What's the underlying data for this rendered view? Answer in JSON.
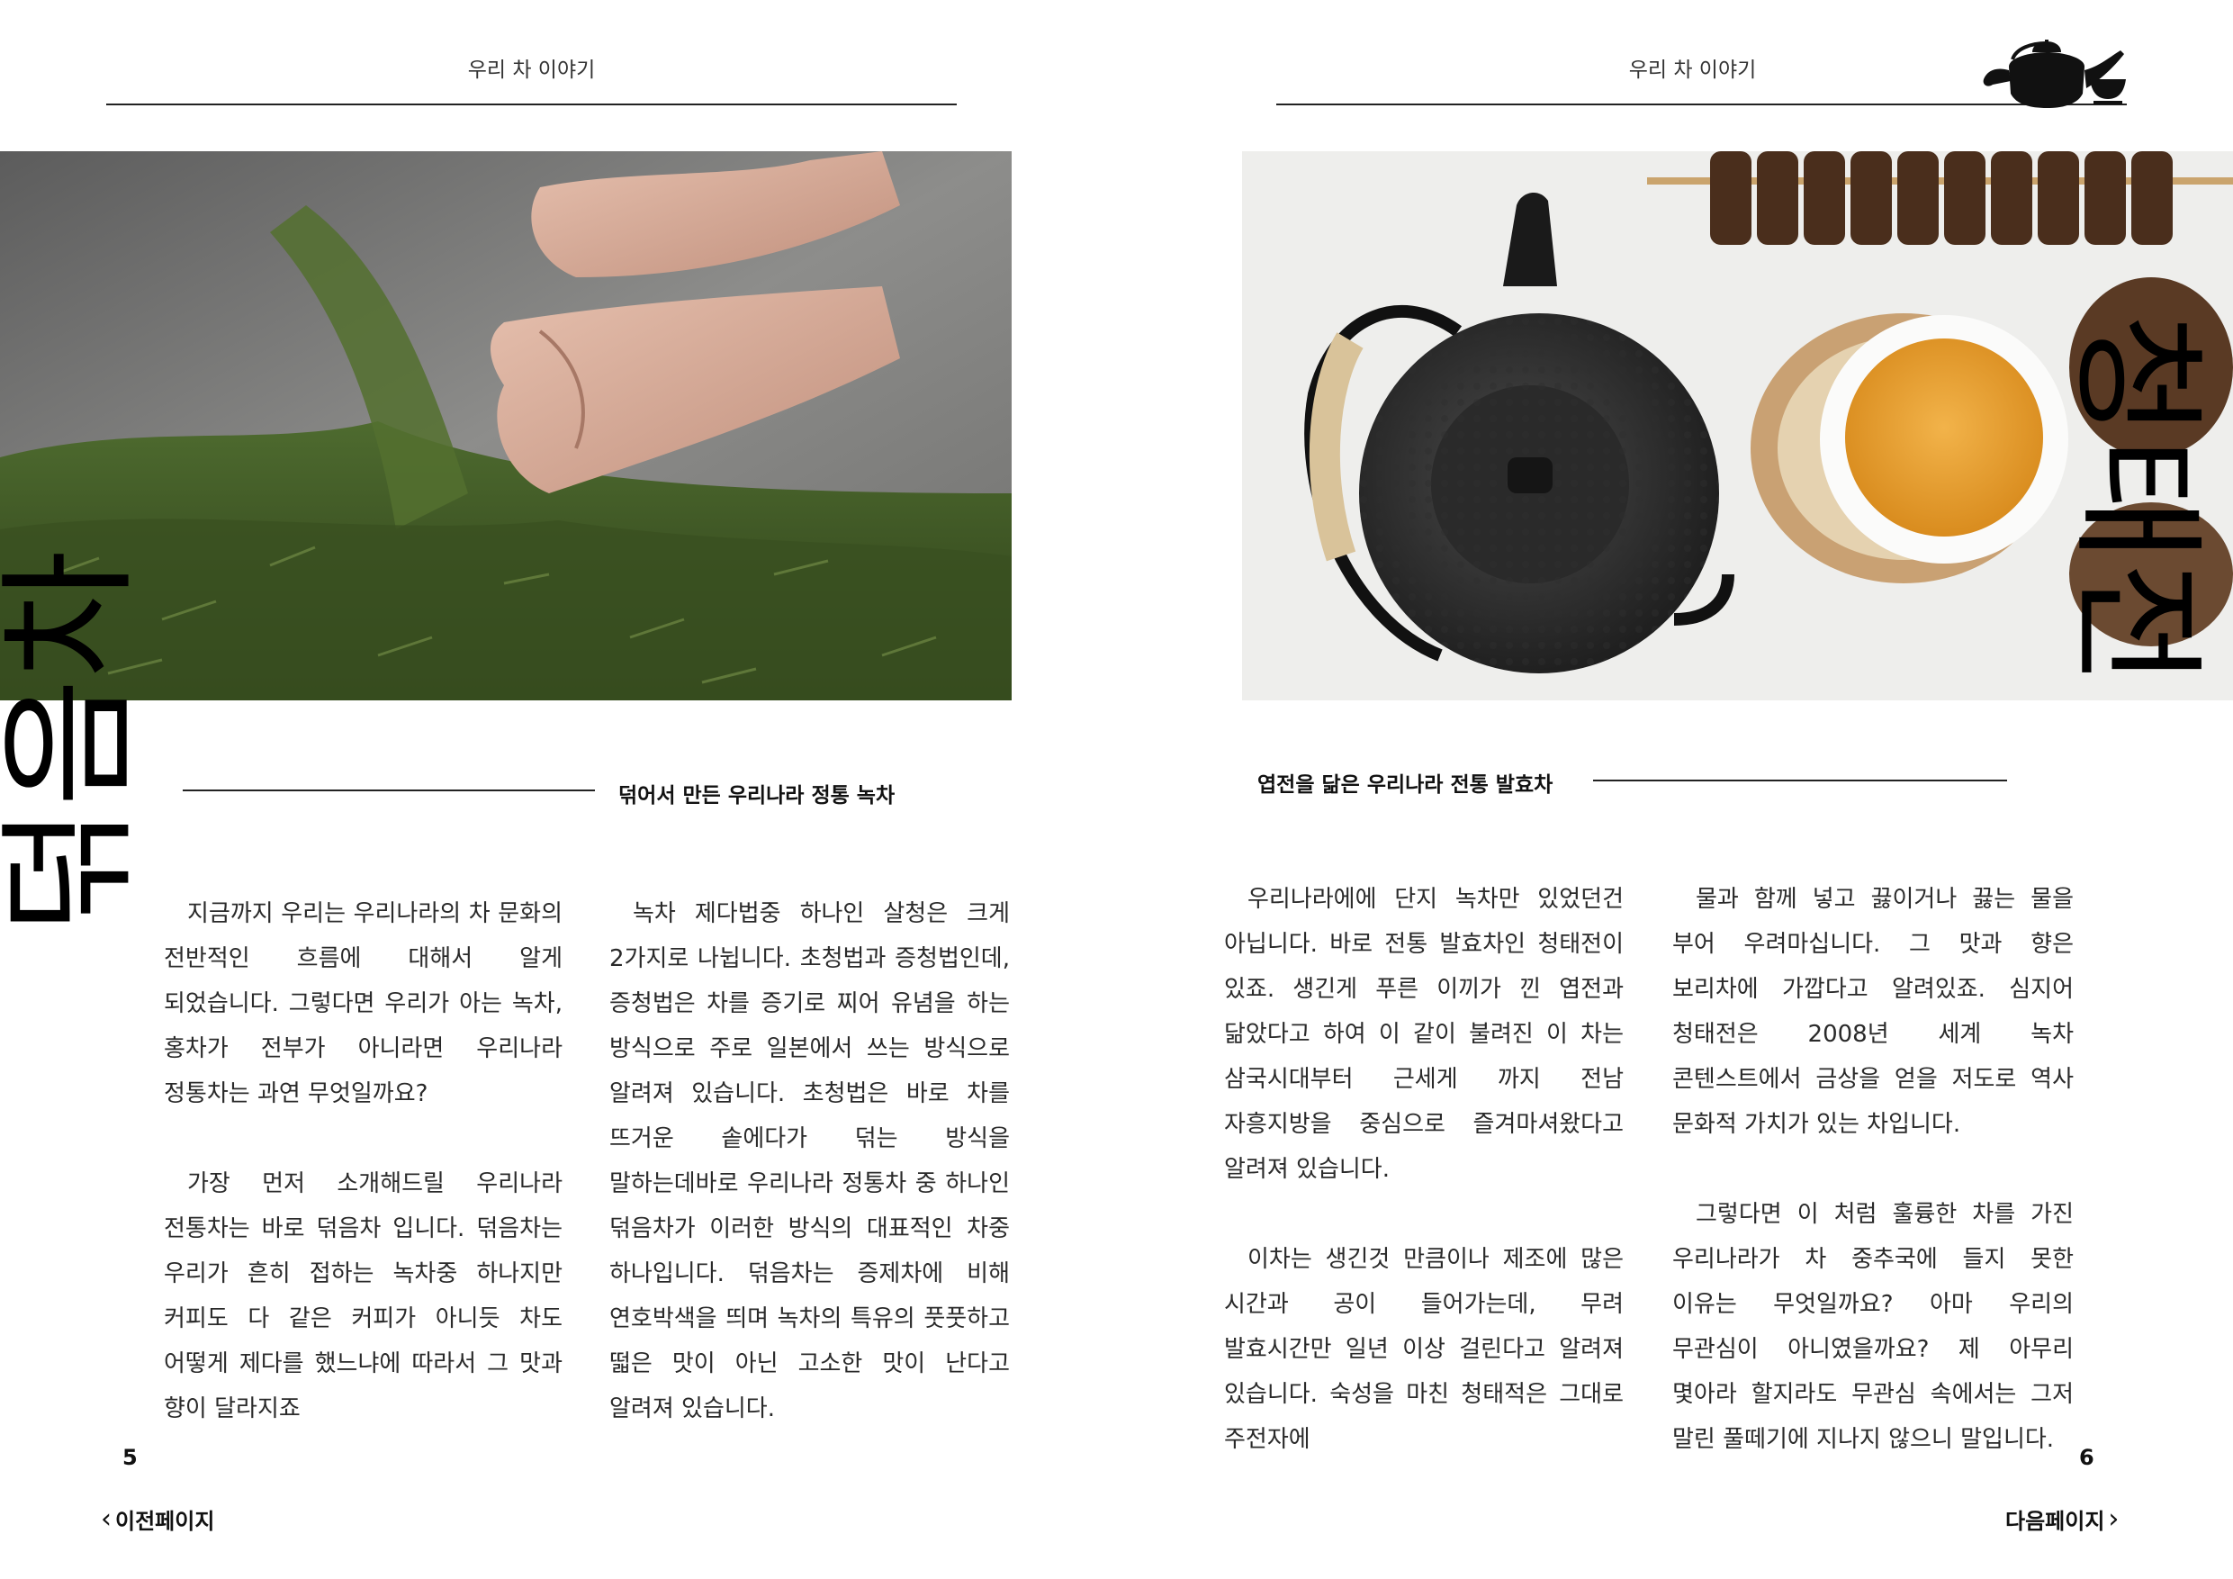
{
  "header": {
    "left_title": "우리 차 이야기",
    "right_title": "우리 차 이야기"
  },
  "icons": {
    "teapot": "teapot-icon",
    "cup": "tea-cup-icon",
    "prev": "chevron-left-icon",
    "next": "chevron-right-icon"
  },
  "left_page": {
    "big_title": "덖음차",
    "subtitle": "덖어서 만든 우리나라 정통 녹차",
    "column1": [
      "지금까지 우리는 우리나라의 차 문화의 전반적인 흐름에 대해서 알게 되었습니다. 그렇다면 우리가 아는 녹차, 홍차가 전부가 아니라면 우리나라 정통차는 과연 무엇일까요?",
      "가장 먼저 소개해드릴 우리나라 전통차는 바로 덖음차 입니다. 덖음차는 우리가 흔히 접하는 녹차중 하나지만 커피도 다 같은 커피가 아니듯 차도 어떻게 제다를 했느냐에 따라서 그 맛과 향이 달라지죠"
    ],
    "column2": [
      "녹차 제다법중 하나인 살청은 크게 2가지로 나뉩니다. 초청법과 증청법인데, 증청법은 차를 증기로 찌어 유념을 하는 방식으로 주로 일본에서 쓰는 방식으로 알려져 있습니다. 초청법은 바로 차를 뜨거운 솥에다가 덖는 방식을 말하는데바로 우리나라 정통차 중 하나인 덖음차가 이러한 방식의 대표적인 차중 하나입니다. 덖음차는 증제차에 비해 연호박색을 띄며 녹차의 특유의 풋풋하고 떫은 맛이 아닌 고소한 맛이 난다고 알려져 있습니다."
    ],
    "page_number": "5",
    "nav_label": "이전페이지"
  },
  "right_page": {
    "big_title": "청태전",
    "subtitle": "엽전을 닮은 우리나라 전통 발효차",
    "column1": [
      "우리나라에에 단지 녹차만 있었던건 아닙니다. 바로 전통 발효차인 청태전이 있죠. 생긴게 푸른 이끼가 낀 엽전과 닮았다고 하여 이 같이 불려진  이 차는 삼국시대부터 근세게 까지 전남 자흥지방을 중심으로 즐겨마셔왔다고 알려져 있습니다.",
      "이차는 생긴것 만큼이나 제조에 많은 시간과 공이 들어가는데, 무려 발효시간만 일년 이상 걸린다고 알려져 있습니다. 숙성을 마친 청태적은 그대로 주전자에"
    ],
    "column2": [
      "물과 함께 넣고 끓이거나 끓는 물을 부어 우려마십니다. 그 맛과 향은 보리차에 가깝다고 알려있죠.  심지어 청태전은 2008년 세계 녹차 콘텐스트에서 금상을 얻을 저도로 역사 문화적 가치가 있는 차입니다.",
      "그렇다면 이 처럼 훌륭한 차를 가진 우리나라가 차 중추국에 들지 못한 이유는 무엇일까요? 아마 우리의 무관심이 아니였을까요? 제 아무리 몇아라 할지라도 무관심 속에서는 그저 말린 풀떼기에 지나지 않으니 말입니다."
    ],
    "page_number": "6",
    "nav_label": "다음페이지"
  }
}
